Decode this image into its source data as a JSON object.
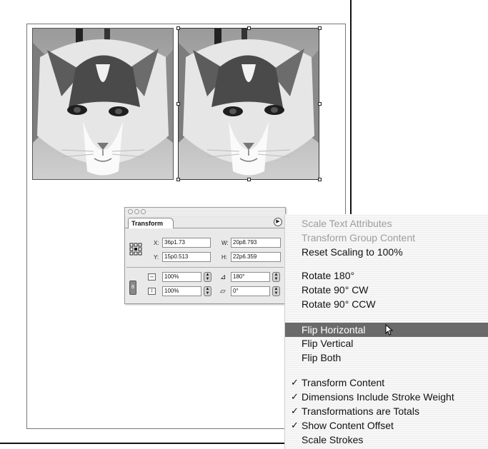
{
  "document": {},
  "transform_panel": {
    "tab_label": "Transform",
    "x_label": "X:",
    "x_value": "36p1.73",
    "y_label": "Y:",
    "y_value": "15p0.513",
    "w_label": "W:",
    "w_value": "20p8.793",
    "h_label": "H:",
    "h_value": "22p6.359",
    "scale_x_value": "100%",
    "scale_y_value": "100%",
    "rotate_value": "180°",
    "shear_value": "0°"
  },
  "menu": {
    "items": [
      {
        "label": "Scale Text Attributes",
        "state": "disabled"
      },
      {
        "label": "Transform Group Content",
        "state": "disabled"
      },
      {
        "label": "Reset Scaling to 100%",
        "state": "normal"
      },
      {
        "label": "Rotate 180°",
        "state": "normal"
      },
      {
        "label": "Rotate 90° CW",
        "state": "normal"
      },
      {
        "label": "Rotate 90° CCW",
        "state": "normal"
      },
      {
        "label": "Flip Horizontal",
        "state": "highlighted"
      },
      {
        "label": "Flip Vertical",
        "state": "normal"
      },
      {
        "label": "Flip Both",
        "state": "normal"
      },
      {
        "label": "Transform Content",
        "state": "checked"
      },
      {
        "label": "Dimensions Include Stroke Weight",
        "state": "checked"
      },
      {
        "label": "Transformations are Totals",
        "state": "checked"
      },
      {
        "label": "Show Content Offset",
        "state": "checked"
      },
      {
        "label": "Scale Strokes",
        "state": "normal"
      }
    ],
    "check_glyph": "✓"
  },
  "colors": {
    "highlight": "#6a6a6a",
    "disabled_text": "#9d9d9d"
  }
}
